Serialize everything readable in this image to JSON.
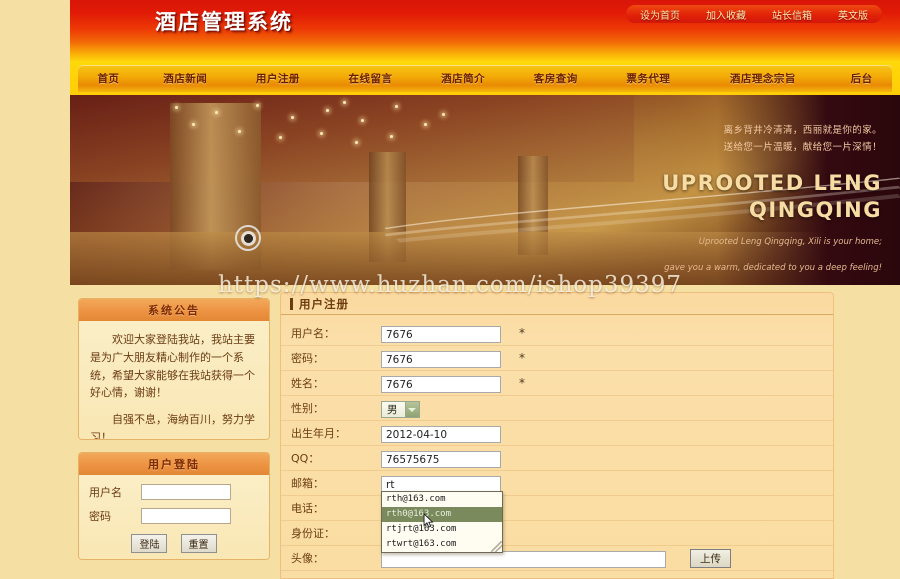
{
  "site": {
    "logo": "酒店管理系统",
    "top_links": [
      "设为首页",
      "加入收藏",
      "站长信箱",
      "英文版"
    ],
    "nav": [
      "首页",
      "酒店新闻",
      "用户注册",
      "在线留言",
      "酒店简介",
      "客房查询",
      "票务代理",
      "酒店理念宗旨",
      "后台"
    ],
    "watermark": "https://www.huzhan.com/ishop39397"
  },
  "banner": {
    "cn_line1": "离乡背井冷清清，西丽就是你的家。",
    "cn_line2": "送给您一片温暖，献给您一片深情！",
    "en_line1": "UPROOTED LENG",
    "en_line2": "QINGQING",
    "sub_line1": "Uprooted Leng Qingqing, Xili is your home;",
    "sub_line2": "gave you a warm, dedicated to you a deep feeling!"
  },
  "announcement": {
    "title": "系统公告",
    "paragraph1": "欢迎大家登陆我站，我站主要是为广大朋友精心制作的一个系统，希望大家能够在我站获得一个好心情，谢谢！",
    "paragraph2": "自强不息，海纳百川，努力学习！"
  },
  "login": {
    "title": "用户登陆",
    "username_label": "用户名",
    "password_label": "密码",
    "username_value": "",
    "password_value": "",
    "submit_label": "登陆",
    "reset_label": "重置"
  },
  "register": {
    "title": "用户注册",
    "required_mark": "*",
    "fields": {
      "username": {
        "label": "用户名：",
        "value": "7676"
      },
      "password": {
        "label": "密码：",
        "value": "7676"
      },
      "realname": {
        "label": "姓名：",
        "value": "7676"
      },
      "gender": {
        "label": "性别：",
        "value": "男"
      },
      "birthdate": {
        "label": "出生年月：",
        "value": "2012-04-10"
      },
      "qq": {
        "label": "QQ：",
        "value": "76575675"
      },
      "email": {
        "label": "邮箱：",
        "value": "rt"
      },
      "phone": {
        "label": "电话：",
        "value": ""
      },
      "idcard": {
        "label": "身份证：",
        "value": ""
      },
      "avatar": {
        "label": "头像：",
        "value": "",
        "upload_label": "上传"
      }
    },
    "autocomplete": {
      "items": [
        "rth@163.com",
        "rth0@163.com",
        "rtjrt@163.com",
        "rtwrt@163.com"
      ],
      "selected_index": 1
    }
  },
  "colors": {
    "header_red": "#d81608",
    "header_yellow": "#ffd90a",
    "page_bg": "#f6dfa3",
    "panel_head": "#ec9343",
    "form_bg": "#fbdfa9",
    "select_highlight": "#7a8a5c"
  }
}
